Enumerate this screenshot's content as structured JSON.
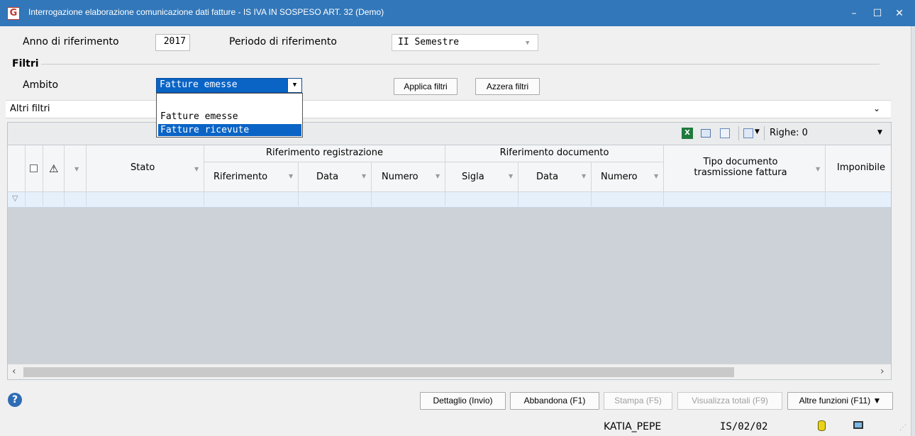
{
  "window": {
    "title": "Interrogazione elaborazione comunicazione dati fatture - IS IVA IN SOSPESO ART. 32  (Demo)",
    "minimize": "–",
    "maximize": "☐",
    "close": "✕"
  },
  "header": {
    "anno_label": "Anno di riferimento",
    "anno_value": "2017",
    "periodo_label": "Periodo di riferimento",
    "periodo_value": "II Semestre"
  },
  "filtri": {
    "title": "Filtri",
    "ambito_label": "Ambito",
    "ambito_value": "Fatture emesse",
    "ambito_options": [
      "",
      "Fatture emesse",
      "Fatture ricevute"
    ],
    "ambito_highlighted": "Fatture ricevute",
    "applica_label": "Applica filtri",
    "azzera_label": "Azzera filtri",
    "altri_label": "Altri filtri"
  },
  "grid": {
    "toolbar": {
      "righe_label": "Righe: 0"
    },
    "group_headers": {
      "registrazione": "Riferimento registrazione",
      "documento": "Riferimento documento"
    },
    "columns": {
      "stato": "Stato",
      "riferimento": "Riferimento",
      "data_reg": "Data",
      "numero_reg": "Numero",
      "sigla": "Sigla",
      "data_doc": "Data",
      "numero_doc": "Numero",
      "tipo_documento": "Tipo documento\ntrasmissione fattura",
      "imponibile": "Imponibile"
    }
  },
  "footer": {
    "dettaglio": "Dettaglio (Invio)",
    "abbandona": "Abbandona (F1)",
    "stampa": "Stampa (F5)",
    "visualizza": "Visualizza totali (F9)",
    "altre": "Altre funzioni (F11) ▼"
  },
  "status": {
    "user": "KATIA_PEPE",
    "code": "IS/02/02"
  },
  "colors": {
    "title_bar": "#3277b9",
    "selection": "#0a64c6"
  }
}
